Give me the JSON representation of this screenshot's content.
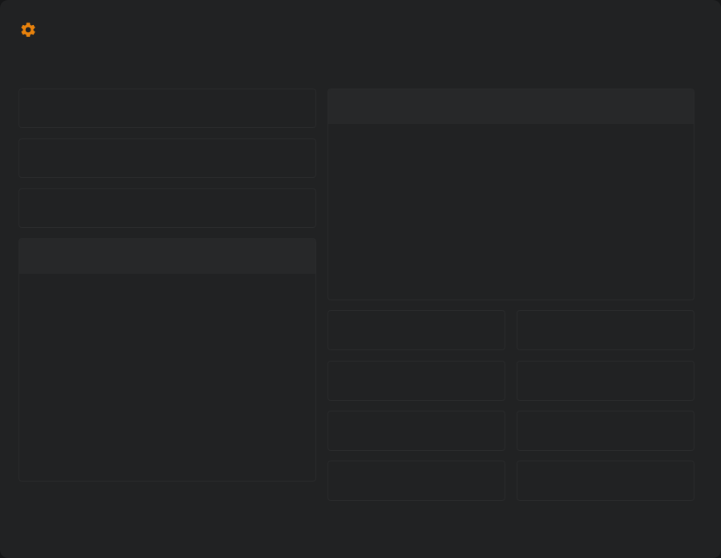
{
  "app": {
    "accent_color": "#e8820c",
    "background_color": "#212223"
  },
  "toolbar": {
    "settings_icon": "gear-icon"
  },
  "left_column": {
    "cards": [
      {
        "label": ""
      },
      {
        "label": ""
      },
      {
        "label": ""
      }
    ],
    "panel": {
      "title": "",
      "body": ""
    }
  },
  "right_column": {
    "panel": {
      "title": "",
      "body": ""
    },
    "grid_cards": [
      {
        "label": ""
      },
      {
        "label": ""
      },
      {
        "label": ""
      },
      {
        "label": ""
      },
      {
        "label": ""
      },
      {
        "label": ""
      },
      {
        "label": ""
      },
      {
        "label": ""
      }
    ]
  }
}
